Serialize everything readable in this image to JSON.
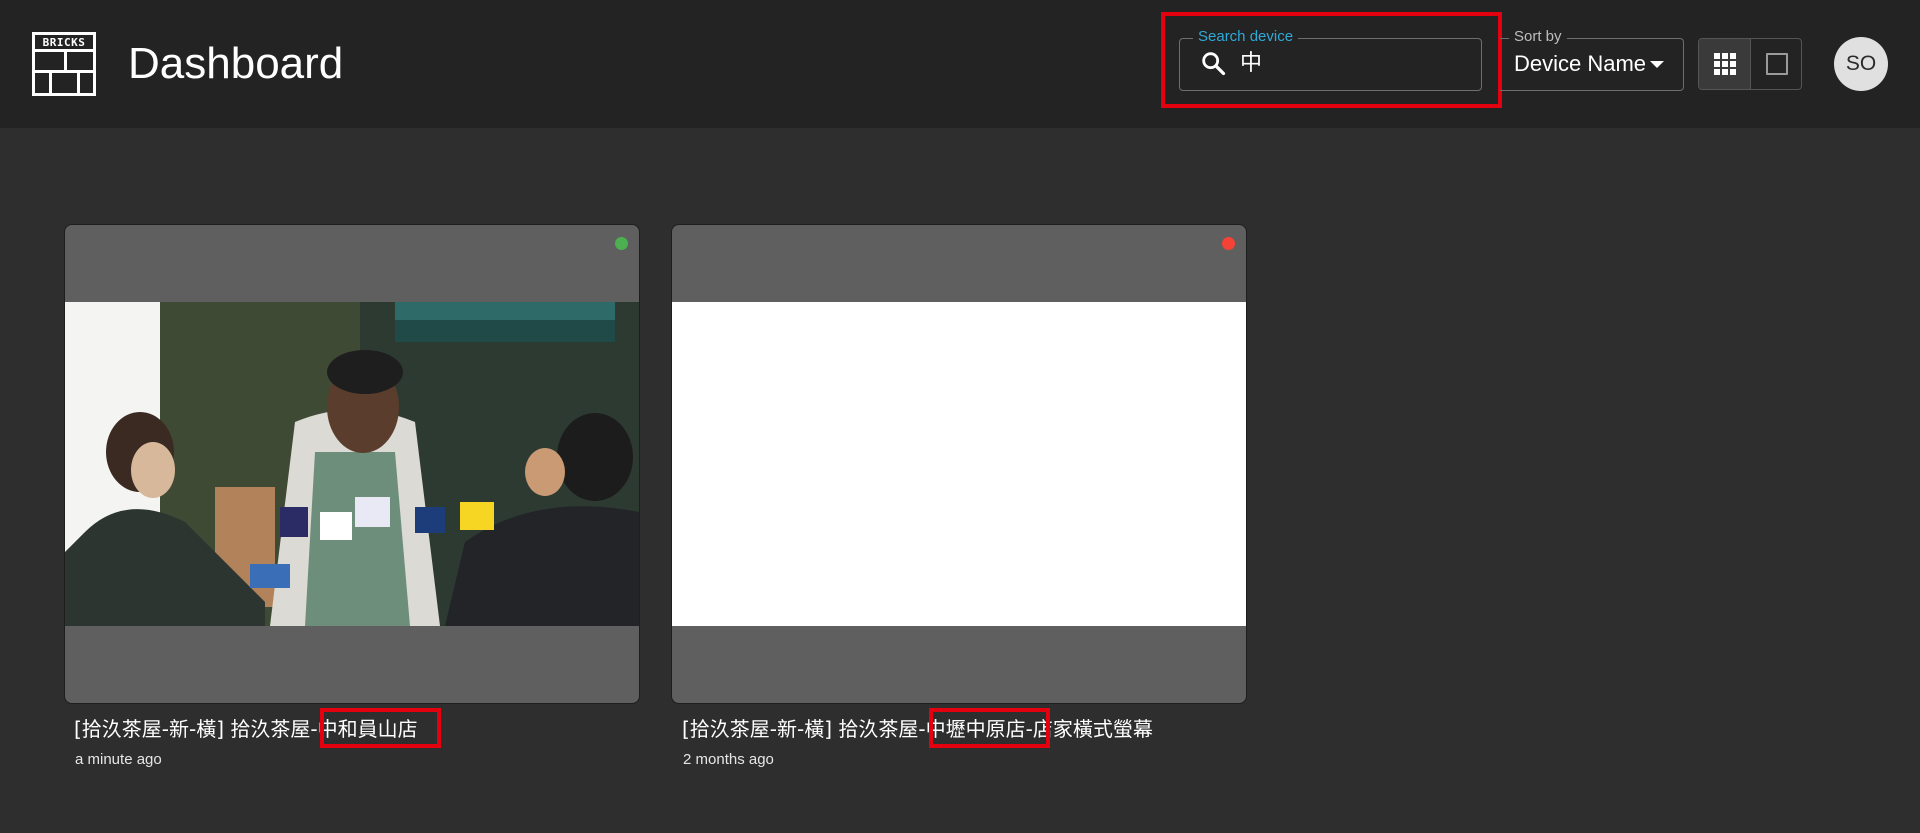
{
  "header": {
    "logo_text": "BRICKS",
    "title": "Dashboard",
    "search": {
      "label": "Search device",
      "value": "中",
      "icon": "search-icon"
    },
    "sort": {
      "label": "Sort by",
      "value": "Device Name",
      "icon": "caret-down-icon"
    },
    "view_toggle": [
      {
        "name": "grid-view",
        "icon": "grid-icon",
        "selected": true
      },
      {
        "name": "single-view",
        "icon": "square-icon",
        "selected": false
      }
    ],
    "avatar_initials": "SO"
  },
  "devices": [
    {
      "title": "[拾汣茶屋-新-橫] 拾汣茶屋-中和員山店",
      "time": "a minute ago",
      "status": "online",
      "status_color": "#4caf50"
    },
    {
      "title": "[拾汣茶屋-新-橫] 拾汣茶屋-中壢中原店-店家橫式螢幕",
      "time": "2 months ago",
      "status": "offline",
      "status_color": "#f44336"
    }
  ],
  "colors": {
    "header_bg": "#232323",
    "page_bg": "#2e2e2e",
    "accent": "#2fa9d7",
    "highlight": "#e3000f"
  }
}
